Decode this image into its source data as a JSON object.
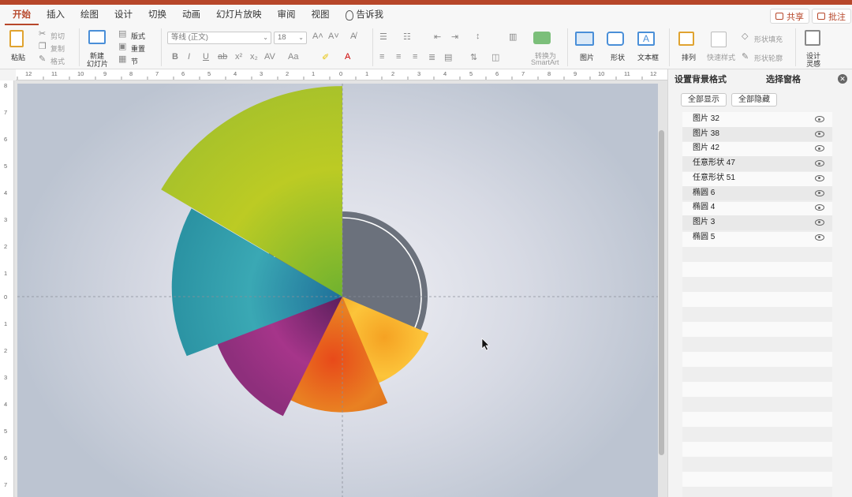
{
  "tabs": [
    "开始",
    "插入",
    "绘图",
    "设计",
    "切换",
    "动画",
    "幻灯片放映",
    "审阅",
    "视图",
    "告诉我"
  ],
  "share_label": "共享",
  "comment_label": "批注",
  "ribbon": {
    "paste": "粘贴",
    "cut": "剪切",
    "copy": "复制",
    "format": "格式",
    "new_slide_1": "新建",
    "new_slide_2": "幻灯片",
    "layout": "版式",
    "reset": "重置",
    "section": "节",
    "font_name": "等线 (正文)",
    "font_size": "18",
    "convert_1": "转换为",
    "convert_2": "SmartArt",
    "picture": "图片",
    "shape": "形状",
    "textbox": "文本框",
    "arrange": "排列",
    "quick_styles": "快速样式",
    "shape_fill": "形状填充",
    "shape_outline": "形状轮廓",
    "designer_1": "设计",
    "designer_2": "灵感"
  },
  "ruler": {
    "h": [
      "12",
      "11",
      "10",
      "9",
      "8",
      "7",
      "6",
      "5",
      "4",
      "3",
      "2",
      "1",
      "0",
      "1",
      "2",
      "3",
      "4",
      "5",
      "6",
      "7",
      "8",
      "9",
      "10",
      "11",
      "12"
    ],
    "v": [
      "8",
      "7",
      "6",
      "5",
      "4",
      "3",
      "2",
      "1",
      "0",
      "1",
      "2",
      "3",
      "4",
      "5",
      "6",
      "7"
    ]
  },
  "panel": {
    "tab_bg": "设置背景格式",
    "tab_sel": "选择窗格",
    "show_all": "全部显示",
    "hide_all": "全部隐藏",
    "items": [
      "图片 32",
      "图片 38",
      "图片 42",
      "任意形状 47",
      "任意形状 51",
      "椭圆 6",
      "椭圆 4",
      "图片 3",
      "椭圆 5"
    ]
  },
  "colors": {
    "accent": "#b7472a",
    "green_segment": "#a3c62d",
    "teal_segment": "#2e9aa8",
    "purple_segment": "#8e2f7c",
    "orange_segment": "#e0701d",
    "yellow_segment": "#f3b52a",
    "gray_circle": "#6b7280"
  },
  "icons": [
    "paste-icon",
    "scissors-icon",
    "copy-icon",
    "format-painter-icon",
    "new-slide-icon",
    "bulb-icon",
    "share-icon",
    "comment-icon",
    "eye-icon",
    "close-icon",
    "cursor-icon"
  ]
}
